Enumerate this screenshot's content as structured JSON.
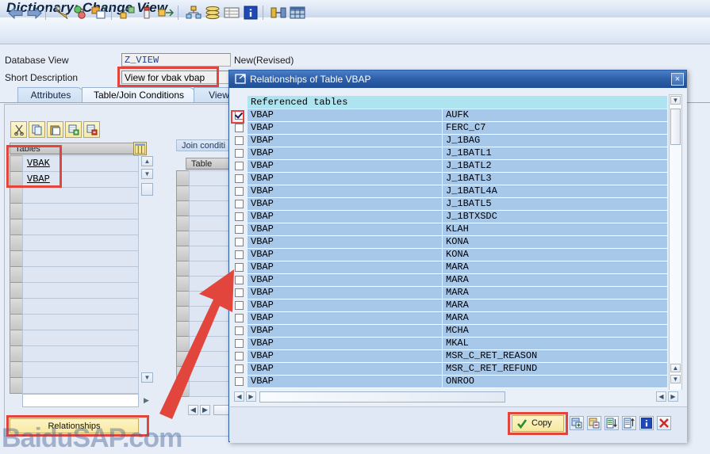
{
  "window": {
    "title": "Dictionary: Change View"
  },
  "toolbar": {
    "items": [
      {
        "name": "back-arrow-icon",
        "label": "Back"
      },
      {
        "name": "forward-arrow-icon",
        "label": "Forward"
      },
      {
        "name": "pencil-display-change-icon",
        "label": "Display <-> Change"
      },
      {
        "name": "check-consistency-icon",
        "label": "Check"
      },
      {
        "name": "activate-icon",
        "label": "Activate"
      },
      {
        "name": "where-used-list-icon",
        "label": "Where-Used List"
      },
      {
        "name": "print-preview-icon",
        "label": "Print Preview"
      },
      {
        "name": "expand-icon",
        "label": "Expand"
      },
      {
        "name": "hierarchy-icon",
        "label": "Hierarchy"
      },
      {
        "name": "database-object-icon",
        "label": "Database Object"
      },
      {
        "name": "table-contents-icon",
        "label": "Table Contents"
      },
      {
        "name": "info-icon",
        "label": "Information"
      },
      {
        "name": "technical-settings-icon",
        "label": "Technical Settings"
      },
      {
        "name": "grid-icon",
        "label": "Contents"
      }
    ]
  },
  "form": {
    "database_view_label": "Database View",
    "database_view_value": "Z_VIEW",
    "status": "New(Revised)",
    "short_description_label": "Short Description",
    "short_description_value": "View for vbak vbap"
  },
  "tabs": [
    {
      "label": "Attributes",
      "selected": false
    },
    {
      "label": "Table/Join Conditions",
      "selected": true
    },
    {
      "label": "View",
      "selected": false
    }
  ],
  "tables_panel": {
    "toolbar": [
      {
        "name": "cut-icon",
        "label": "Cut"
      },
      {
        "name": "copy-icon",
        "label": "Copy"
      },
      {
        "name": "paste-icon",
        "label": "Paste"
      },
      {
        "name": "insert-row-icon",
        "label": "Insert Row"
      },
      {
        "name": "delete-row-icon",
        "label": "Delete Row"
      }
    ],
    "column_header": "Tables",
    "rows": [
      "VBAK",
      "VBAP"
    ],
    "relationships_button": "Relationships"
  },
  "join_panel": {
    "title": "Join conditi",
    "column_header": "Table"
  },
  "dialog": {
    "title": "Relationships of Table VBAP",
    "close_label": "×",
    "list_header": "Referenced tables",
    "rows": [
      {
        "checked": true,
        "table": "VBAP",
        "referenced": "AUFK"
      },
      {
        "checked": false,
        "table": "VBAP",
        "referenced": "FERC_C7"
      },
      {
        "checked": false,
        "table": "VBAP",
        "referenced": "J_1BAG"
      },
      {
        "checked": false,
        "table": "VBAP",
        "referenced": "J_1BATL1"
      },
      {
        "checked": false,
        "table": "VBAP",
        "referenced": "J_1BATL2"
      },
      {
        "checked": false,
        "table": "VBAP",
        "referenced": "J_1BATL3"
      },
      {
        "checked": false,
        "table": "VBAP",
        "referenced": "J_1BATL4A"
      },
      {
        "checked": false,
        "table": "VBAP",
        "referenced": "J_1BATL5"
      },
      {
        "checked": false,
        "table": "VBAP",
        "referenced": "J_1BTXSDC"
      },
      {
        "checked": false,
        "table": "VBAP",
        "referenced": "KLAH"
      },
      {
        "checked": false,
        "table": "VBAP",
        "referenced": "KONA"
      },
      {
        "checked": false,
        "table": "VBAP",
        "referenced": "KONA"
      },
      {
        "checked": false,
        "table": "VBAP",
        "referenced": "MARA"
      },
      {
        "checked": false,
        "table": "VBAP",
        "referenced": "MARA"
      },
      {
        "checked": false,
        "table": "VBAP",
        "referenced": "MARA"
      },
      {
        "checked": false,
        "table": "VBAP",
        "referenced": "MARA"
      },
      {
        "checked": false,
        "table": "VBAP",
        "referenced": "MARA"
      },
      {
        "checked": false,
        "table": "VBAP",
        "referenced": "MCHA"
      },
      {
        "checked": false,
        "table": "VBAP",
        "referenced": "MKAL"
      },
      {
        "checked": false,
        "table": "VBAP",
        "referenced": "MSR_C_RET_REASON"
      },
      {
        "checked": false,
        "table": "VBAP",
        "referenced": "MSR_C_RET_REFUND"
      },
      {
        "checked": false,
        "table": "VBAP",
        "referenced": "ONROO"
      }
    ],
    "footer": {
      "copy_label": "Copy",
      "buttons": [
        {
          "name": "select-all-icon",
          "label": "Select All"
        },
        {
          "name": "deselect-all-icon",
          "label": "Deselect All"
        },
        {
          "name": "sort-ascending-icon",
          "label": "Sort Ascending"
        },
        {
          "name": "sort-descending-icon",
          "label": "Sort Descending"
        },
        {
          "name": "info-icon",
          "label": "Information"
        },
        {
          "name": "cancel-icon",
          "label": "Cancel"
        }
      ]
    }
  },
  "watermark": "BaiduSAP.com",
  "colors": {
    "accent": "#2f62ab",
    "highlight": "#e2453c",
    "row": "#a8c8ea",
    "header": "#aee4ef",
    "button": "#f8e9a0"
  }
}
